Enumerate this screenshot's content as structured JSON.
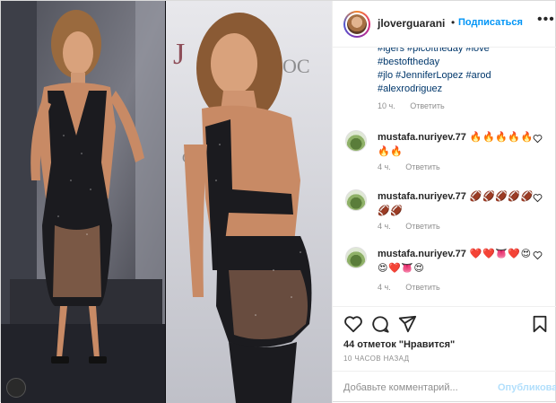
{
  "header": {
    "username": "jloverguarani",
    "dot": "•",
    "follow_label": "Подписаться",
    "more_label": "•••"
  },
  "caption": {
    "tags": [
      "#igers #picoftheday #love",
      "#bestoftheday",
      "#jlo #JenniferLopez #arod",
      "#alexrodriguez"
    ],
    "time": "10 ч.",
    "reply": "Ответить"
  },
  "comments": [
    {
      "user": "mustafa.nuriyev.77",
      "body": "🔥🔥🔥🔥🔥🔥🔥",
      "time": "4 ч.",
      "reply": "Ответить"
    },
    {
      "user": "mustafa.nuriyev.77",
      "body": "🏈🏈🏈🏈🏈🏈🏈",
      "time": "4 ч.",
      "reply": "Ответить"
    },
    {
      "user": "mustafa.nuriyev.77",
      "body": "❤️❤️👅❤️😍😍❤️👅😍",
      "time": "4 ч.",
      "reply": "Ответить"
    }
  ],
  "stats": {
    "likes": "44 отметок \"Нравится\"",
    "posted_ago": "10 ЧАСОВ НАЗАД"
  },
  "composer": {
    "placeholder": "Добавьте комментарий...",
    "publish_label": "Опубликовать"
  },
  "photo": {
    "left_background": "#6a6a73",
    "right_background": "#7f8087",
    "dress": "#1b1b1f",
    "skin": "#c88a65",
    "hair": "#8a5a34"
  }
}
